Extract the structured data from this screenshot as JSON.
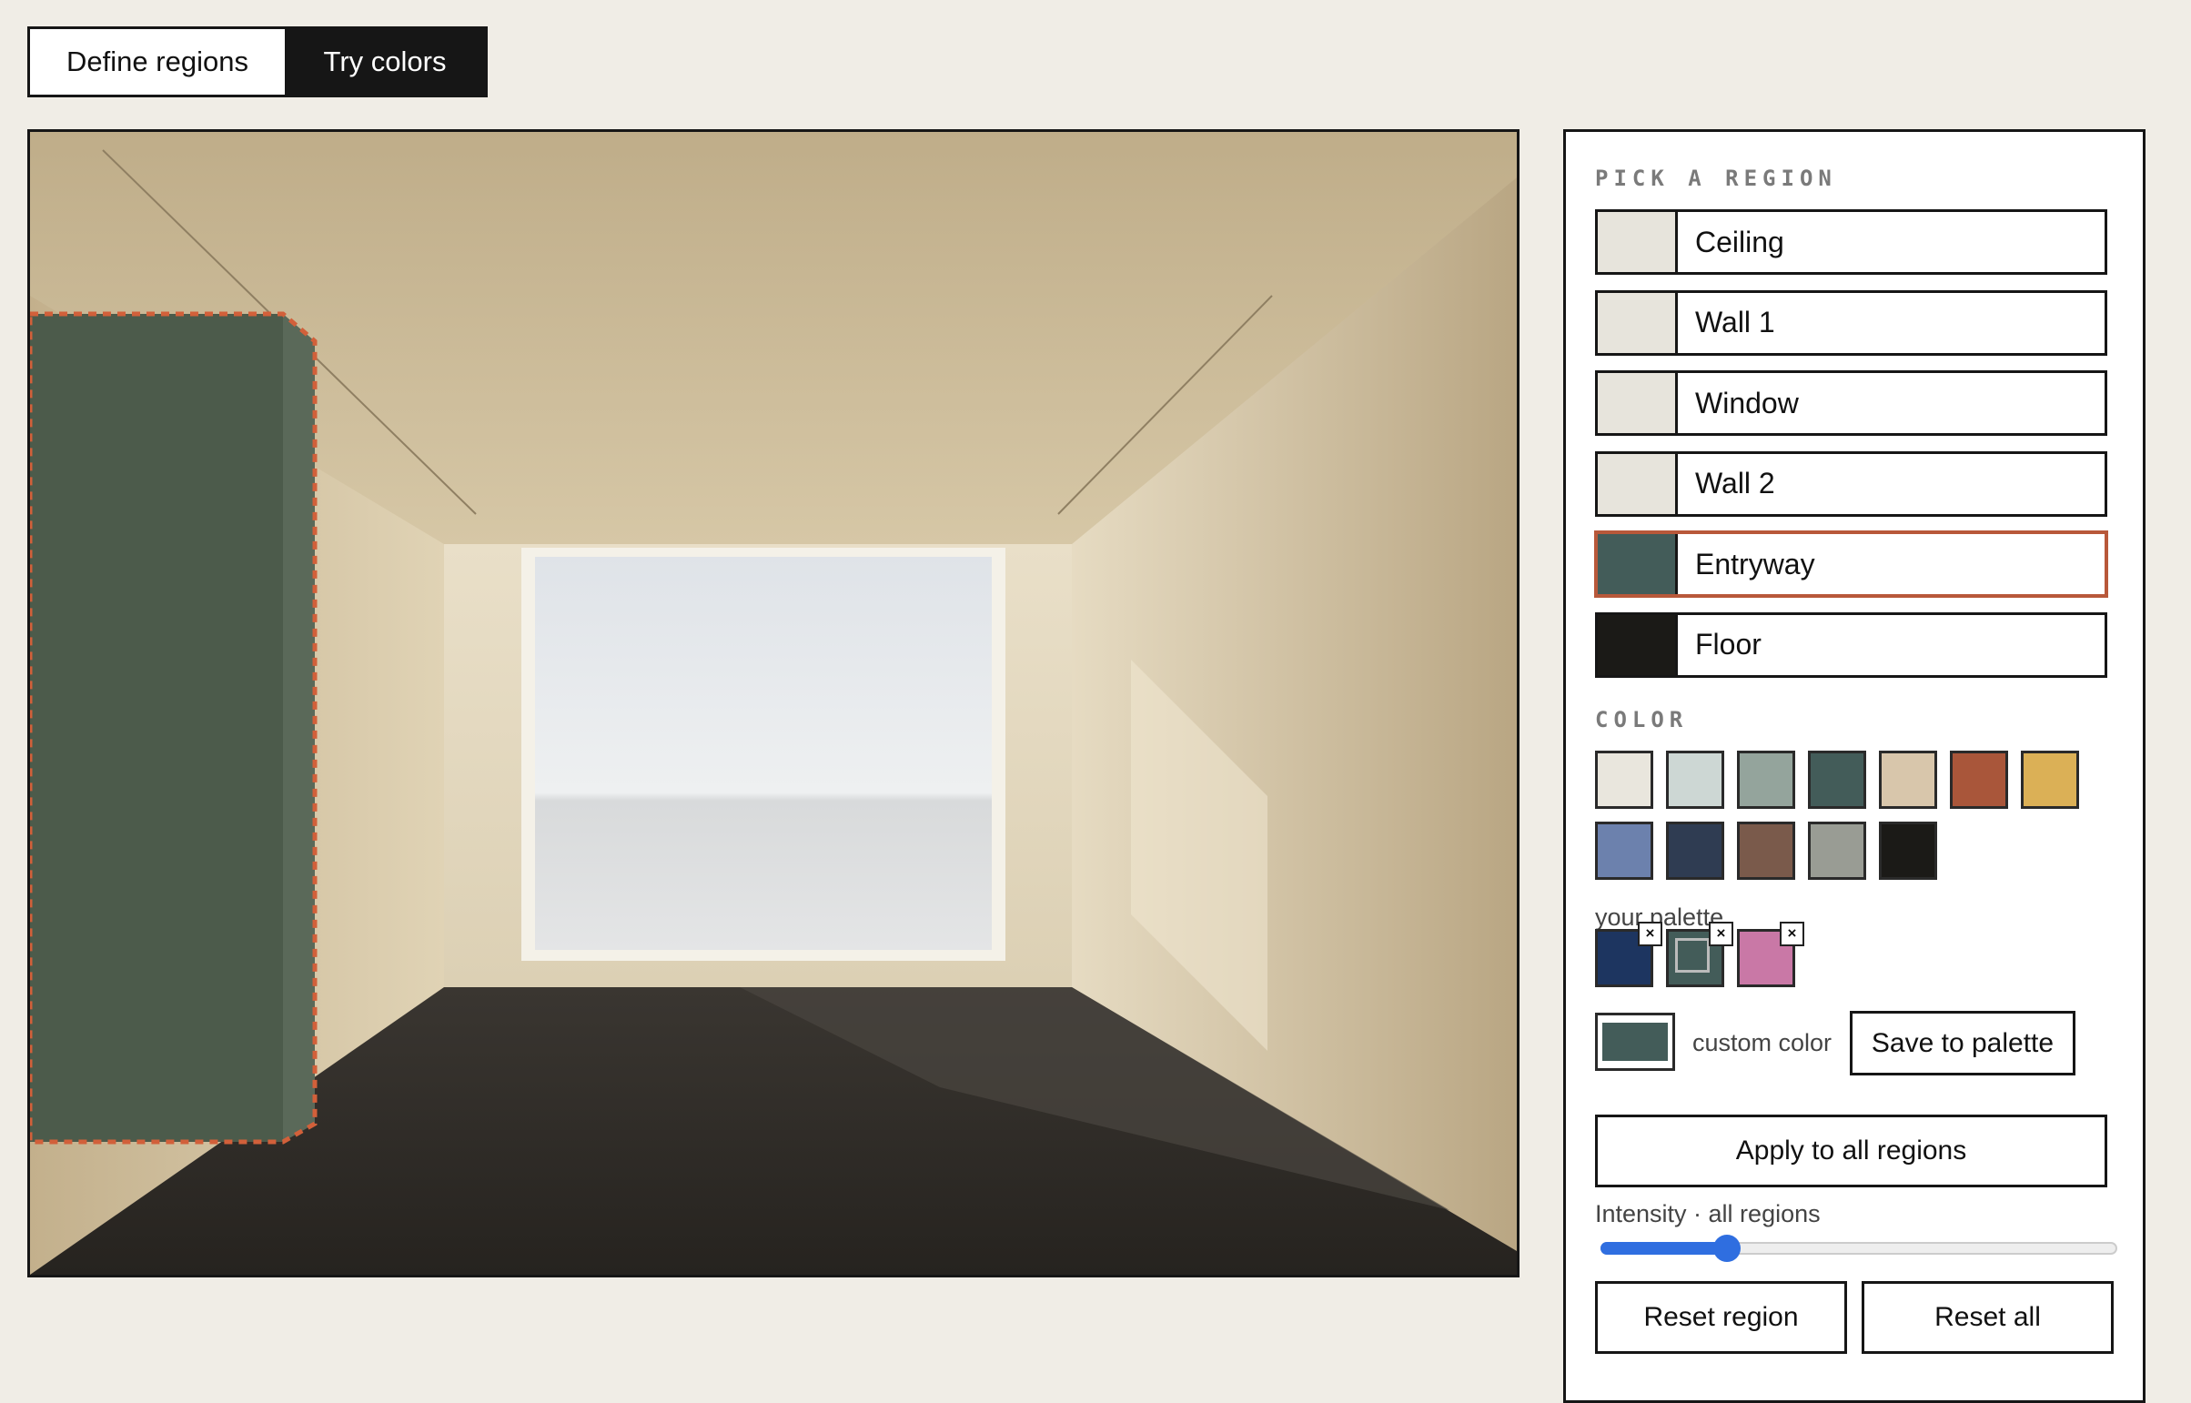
{
  "mode_tabs": {
    "define": "Define regions",
    "try": "Try colors",
    "active": "try"
  },
  "panel": {
    "pick_label": "PICK A REGION",
    "regions": [
      {
        "label": "Ceiling",
        "color": "#e7e4dc"
      },
      {
        "label": "Wall 1",
        "color": "#e7e4dc"
      },
      {
        "label": "Window",
        "color": "#e7e4dc"
      },
      {
        "label": "Wall 2",
        "color": "#e7e4dc"
      },
      {
        "label": "Entryway",
        "color": "#435c59",
        "selected": true
      },
      {
        "label": "Floor",
        "color": "#1b1a17"
      }
    ],
    "color_label": "COLOR",
    "swatches": [
      "#e9e6dd",
      "#cdd7d4",
      "#94a49c",
      "#435c59",
      "#d8c6ab",
      "#a9563a",
      "#dbb056",
      "#6c81ad",
      "#2f3c52",
      "#7a5a4b",
      "#999c94",
      "#1b1a17"
    ],
    "palette_label": "your palette",
    "palette": [
      {
        "color": "#1d3560",
        "remove": "×"
      },
      {
        "color": "#435c59",
        "remove": "×",
        "selected": true
      },
      {
        "color": "#c978a6",
        "remove": "×"
      }
    ],
    "custom_color": "#435c59",
    "custom_label": "custom color",
    "save_label": "Save to palette",
    "apply_all_label": "Apply to all regions",
    "intensity_label": "Intensity · all regions",
    "intensity_value": 0.23,
    "reset_region_label": "Reset region",
    "reset_all_label": "Reset all"
  },
  "scene": {
    "entryway_color": "#4c5b4b",
    "selection_outline_color": "#d2603a"
  }
}
